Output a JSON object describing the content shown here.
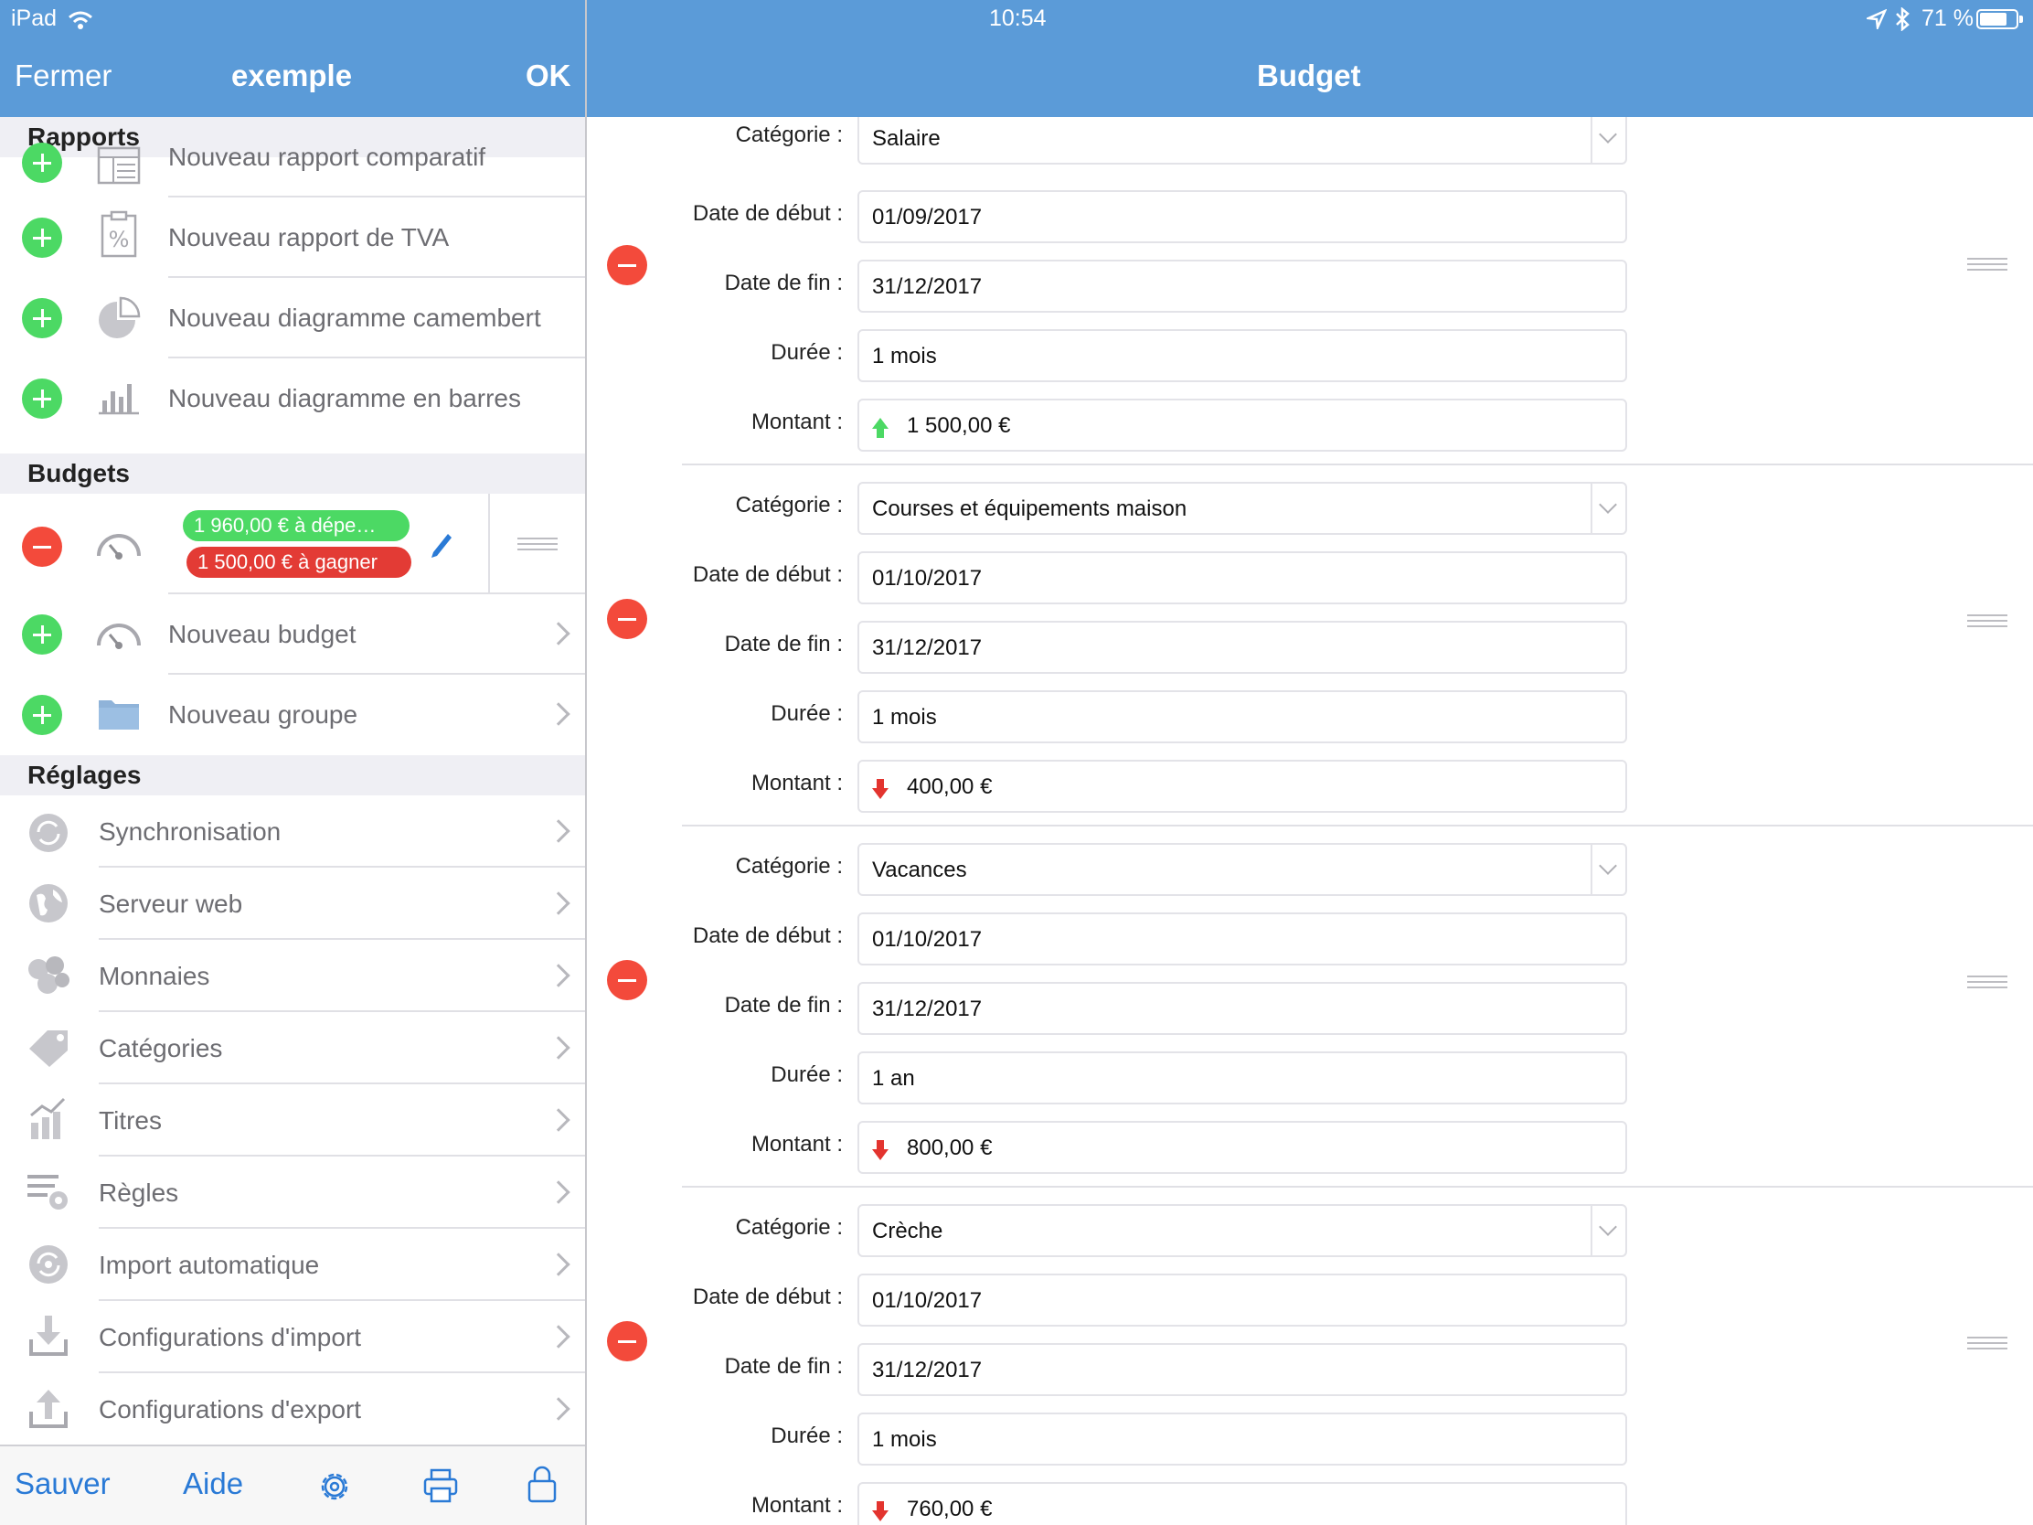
{
  "status_bar": {
    "device": "iPad",
    "time": "10:54",
    "battery": "71 %"
  },
  "left_nav": {
    "close": "Fermer",
    "title": "exemple",
    "ok": "OK"
  },
  "right_nav": {
    "title": "Budget"
  },
  "sections": {
    "reports": {
      "title": "Rapports",
      "items": [
        {
          "label": "Nouveau rapport comparatif",
          "icon": "report-table-icon"
        },
        {
          "label": "Nouveau rapport de TVA",
          "icon": "vat-report-icon"
        },
        {
          "label": "Nouveau diagramme camembert",
          "icon": "pie-chart-icon"
        },
        {
          "label": "Nouveau diagramme en barres",
          "icon": "bar-chart-icon"
        }
      ]
    },
    "budgets": {
      "title": "Budgets",
      "current": {
        "spend": "1 960,00 € à dépe…",
        "earn": "1 500,00 € à gagner"
      },
      "items": [
        {
          "label": "Nouveau budget",
          "icon": "gauge-icon"
        },
        {
          "label": "Nouveau groupe",
          "icon": "folder-icon"
        }
      ]
    },
    "settings": {
      "title": "Réglages",
      "items": [
        {
          "label": "Synchronisation",
          "icon": "sync-icon"
        },
        {
          "label": "Serveur web",
          "icon": "globe-icon"
        },
        {
          "label": "Monnaies",
          "icon": "coins-icon"
        },
        {
          "label": "Catégories",
          "icon": "tag-icon"
        },
        {
          "label": "Titres",
          "icon": "stocks-icon"
        },
        {
          "label": "Règles",
          "icon": "rules-icon"
        },
        {
          "label": "Import automatique",
          "icon": "auto-import-icon"
        },
        {
          "label": "Configurations d'import",
          "icon": "import-icon"
        },
        {
          "label": "Configurations d'export",
          "icon": "export-icon"
        }
      ]
    }
  },
  "toolbar": {
    "save": "Sauver",
    "help": "Aide",
    "settings_icon": "gear-icon",
    "print_icon": "printer-icon",
    "lock_icon": "lock-icon"
  },
  "form_labels": {
    "category": "Catégorie :",
    "start": "Date de début :",
    "end": "Date de fin :",
    "duration": "Durée :",
    "amount": "Montant :"
  },
  "budget_entries": [
    {
      "category": "Salaire",
      "start": "01/09/2017",
      "end": "31/12/2017",
      "duration": "1 mois",
      "amount": "1 500,00 €",
      "direction": "up"
    },
    {
      "category": "Courses et équipements maison",
      "start": "01/10/2017",
      "end": "31/12/2017",
      "duration": "1 mois",
      "amount": "400,00 €",
      "direction": "down"
    },
    {
      "category": "Vacances",
      "start": "01/10/2017",
      "end": "31/12/2017",
      "duration": "1 an",
      "amount": "800,00 €",
      "direction": "down"
    },
    {
      "category": "Crèche",
      "start": "01/10/2017",
      "end": "31/12/2017",
      "duration": "1 mois",
      "amount": "760,00 €",
      "direction": "down"
    }
  ],
  "colors": {
    "nav": "#5b9bd8",
    "add": "#4cd964",
    "remove": "#f34a3b",
    "link": "#2a7ad6",
    "earn_badge": "#e33b35",
    "spend_badge": "#4cd964"
  }
}
